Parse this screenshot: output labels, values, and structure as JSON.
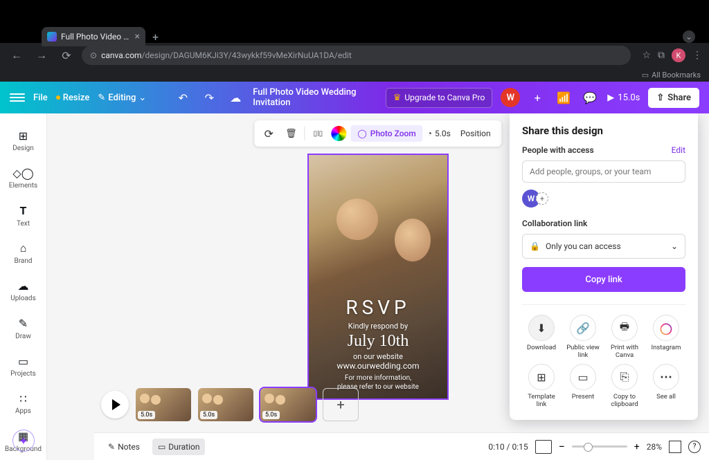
{
  "browser": {
    "tab_title": "Full Photo Video Wedding Inv",
    "url_domain": "canva.com",
    "url_path": "/design/DAGUM6KJi3Y/43wykkf59vMeXirNuUA1DA/edit",
    "profile_letter": "K",
    "all_bookmarks": "All Bookmarks"
  },
  "header": {
    "file": "File",
    "resize": "Resize",
    "editing": "Editing",
    "design_name": "Full Photo Video Wedding Invitation",
    "upgrade": "Upgrade to Canva Pro",
    "avatar": "W",
    "play_duration": "15.0s",
    "share": "Share"
  },
  "rail": {
    "items": [
      {
        "label": "Design"
      },
      {
        "label": "Elements"
      },
      {
        "label": "Text"
      },
      {
        "label": "Brand"
      },
      {
        "label": "Uploads"
      },
      {
        "label": "Draw"
      },
      {
        "label": "Projects"
      },
      {
        "label": "Apps"
      },
      {
        "label": "Background"
      }
    ]
  },
  "canvas_toolbar": {
    "photo_zoom": "Photo Zoom",
    "time": "5.0s",
    "position": "Position"
  },
  "canvas_text": {
    "rsvp": "RSVP",
    "kindly": "Kindly respond by",
    "date": "July 10th",
    "website_label": "on our website",
    "website_url": "www.ourwedding.com",
    "info1": "For more information,",
    "info2": "please refer to our website"
  },
  "timeline": {
    "clip_dur": "5.0s"
  },
  "bottombar": {
    "notes": "Notes",
    "duration": "Duration",
    "time": "0:10 / 0:15",
    "zoom": "28%"
  },
  "share_panel": {
    "title": "Share this design",
    "people_label": "People with access",
    "edit": "Edit",
    "add_placeholder": "Add people, groups, or your team",
    "avatar": "W",
    "collab_label": "Collaboration link",
    "access_value": "Only you can access",
    "copy_link": "Copy link",
    "options": [
      {
        "label": "Download"
      },
      {
        "label": "Public view link"
      },
      {
        "label": "Print with Canva"
      },
      {
        "label": "Instagram"
      },
      {
        "label": "Template link"
      },
      {
        "label": "Present"
      },
      {
        "label": "Copy to clipboard"
      },
      {
        "label": "See all"
      }
    ]
  }
}
